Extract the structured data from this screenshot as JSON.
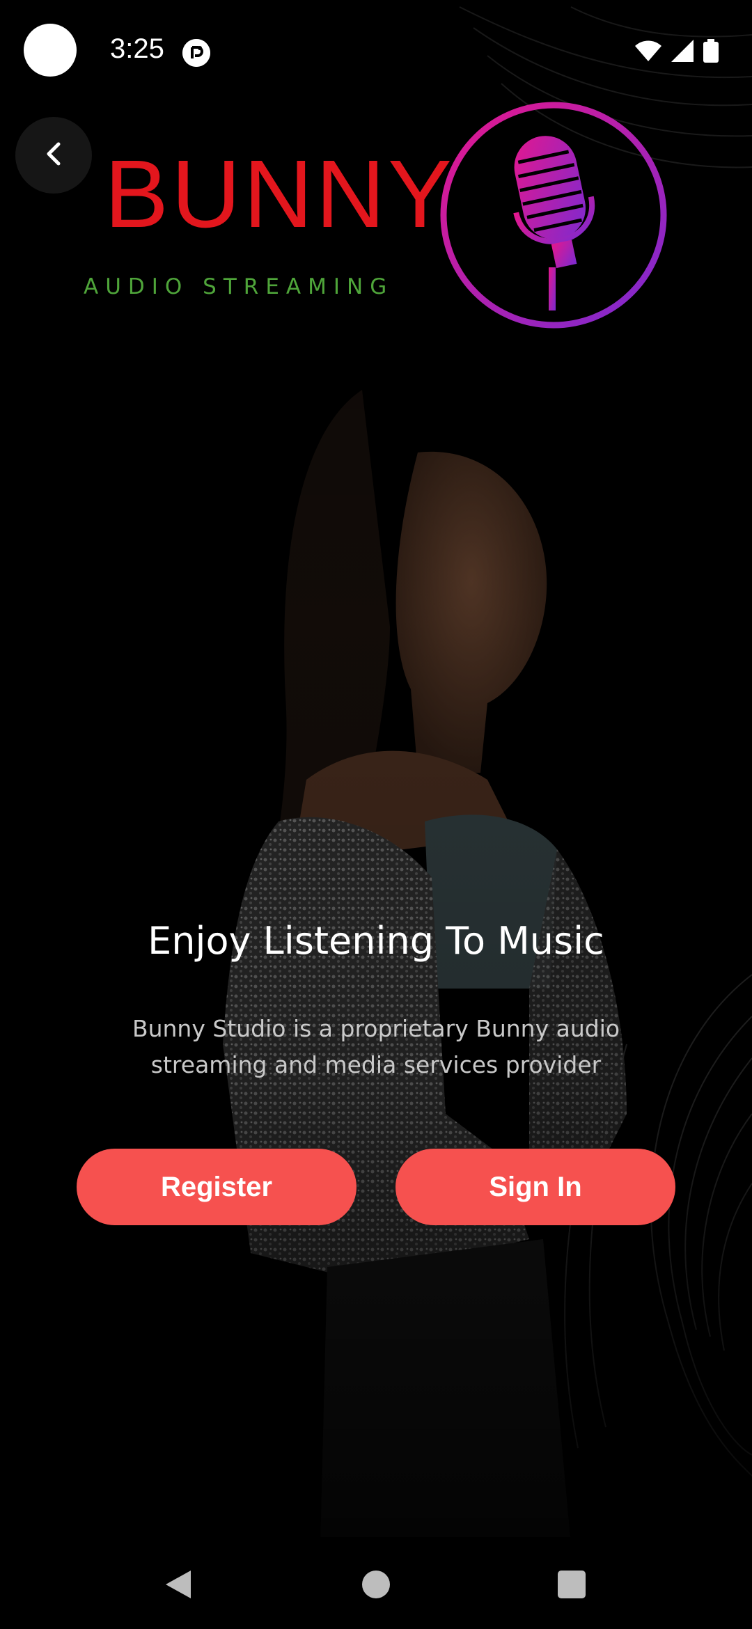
{
  "status_bar": {
    "time": "3:25"
  },
  "logo": {
    "word": "BUNNY",
    "subtitle": "AUDIO STREAMING"
  },
  "content": {
    "headline": "Enjoy Listening To Music",
    "description": "Bunny Studio is a proprietary Bunny audio streaming and media services provider"
  },
  "buttons": {
    "register": "Register",
    "sign_in": "Sign In"
  },
  "colors": {
    "accent": "#f6514f",
    "logo_red": "#e3161d",
    "logo_green": "#4fa53a",
    "mic_gradient_start": "#e5178d",
    "mic_gradient_end": "#7b2ad1"
  },
  "icons": {
    "back": "chevron-left-icon",
    "wifi": "wifi-icon",
    "signal": "signal-icon",
    "battery": "battery-icon",
    "nav_back": "nav-back-triangle-icon",
    "nav_home": "nav-home-circle-icon",
    "nav_recents": "nav-recents-square-icon"
  }
}
